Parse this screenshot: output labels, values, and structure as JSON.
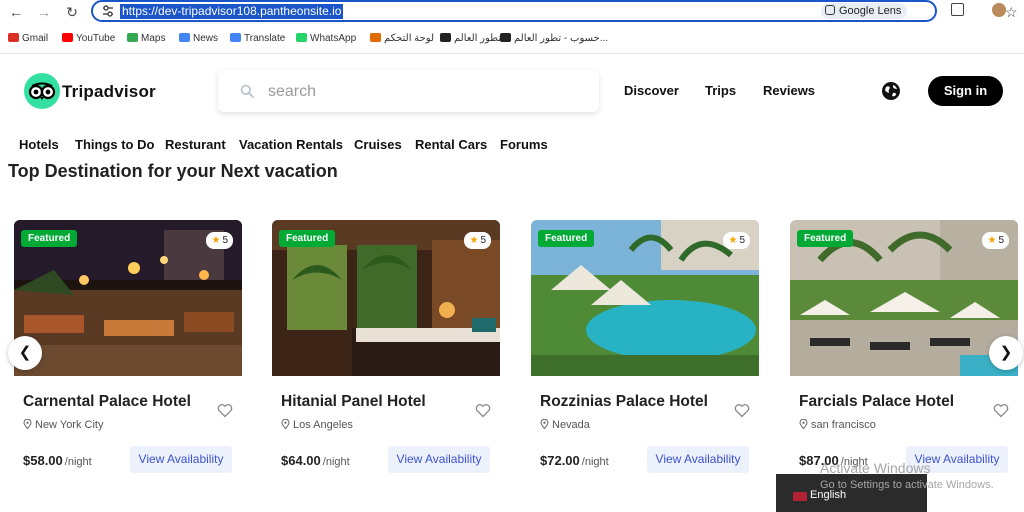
{
  "browser": {
    "url": "https://dev-tripadvisor108.pantheonsite.io",
    "lens_label": "Google Lens",
    "bookmarks": [
      {
        "label": "Gmail",
        "icon": "gmail-icon",
        "color": "#d93025"
      },
      {
        "label": "YouTube",
        "icon": "youtube-icon",
        "color": "#ff0000"
      },
      {
        "label": "Maps",
        "icon": "maps-icon",
        "color": "#34a853"
      },
      {
        "label": "News",
        "icon": "news-icon",
        "color": "#4285f4"
      },
      {
        "label": "Translate",
        "icon": "translate-icon",
        "color": "#4285f4"
      },
      {
        "label": "WhatsApp",
        "icon": "whatsapp-icon",
        "color": "#25d366"
      },
      {
        "label": "لوحة التحكم",
        "icon": "bookmark-icon",
        "color": "#e06b00"
      },
      {
        "label": "تطور العالم...",
        "icon": "bookmark-icon",
        "color": "#222222"
      },
      {
        "label": "حسوب - تطور العالم...",
        "icon": "bookmark-icon",
        "color": "#222222"
      }
    ]
  },
  "site": {
    "brand": "Tripadvisor",
    "brand_color": "#34e0a1",
    "search_placeholder": "search",
    "main_nav": [
      "Discover",
      "Trips",
      "Reviews"
    ],
    "signin_label": "Sign in",
    "categories": [
      "Hotels",
      "Things to Do",
      "Resturant",
      "Vacation Rentals",
      "Cruises",
      "Rental Cars",
      "Forums"
    ],
    "section_title": "Top Destination for your Next vacation"
  },
  "cards": [
    {
      "badge": "Featured",
      "rating": "5",
      "title": "Carnental Palace Hotel",
      "location": "New York City",
      "price": "$58.00",
      "per": "/night",
      "cta": "View Availability"
    },
    {
      "badge": "Featured",
      "rating": "5",
      "title": "Hitanial Panel Hotel",
      "location": "Los Angeles",
      "price": "$64.00",
      "per": "/night",
      "cta": "View Availability"
    },
    {
      "badge": "Featured",
      "rating": "5",
      "title": "Rozzinias Palace Hotel",
      "location": "Nevada",
      "price": "$72.00",
      "per": "/night",
      "cta": "View Availability"
    },
    {
      "badge": "Featured",
      "rating": "5",
      "title": "Farcials Palace Hotel",
      "location": "san francisco",
      "price": "$87.00",
      "per": "/night",
      "cta": "View Availability"
    }
  ],
  "overlay": {
    "activate_title": "Activate Windows",
    "activate_sub": "Go to Settings to activate Windows.",
    "language": "English"
  },
  "colors": {
    "featured_badge": "#00aa35",
    "availability_text": "#3b52d1",
    "availability_bg": "#edf1fb"
  }
}
